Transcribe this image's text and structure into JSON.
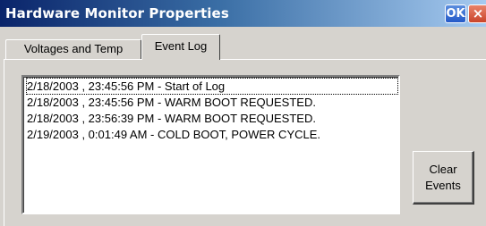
{
  "window": {
    "title": "Hardware Monitor Properties",
    "ok_label": "OK",
    "close_label": "×"
  },
  "tabs": [
    {
      "label": "Voltages and Temp",
      "active": false
    },
    {
      "label": "Event Log",
      "active": true
    }
  ],
  "event_log": {
    "entries": [
      "2/18/2003 , 23:45:56 PM - Start of Log",
      "2/18/2003 , 23:45:56 PM - WARM BOOT REQUESTED.",
      "2/18/2003 , 23:56:39 PM - WARM BOOT REQUESTED.",
      "2/19/2003 , 0:01:49 AM - COLD BOOT, POWER CYCLE."
    ]
  },
  "clear_button": {
    "line1": "Clear",
    "line2": "Events"
  },
  "colors": {
    "title_gradient_start": "#0a246a",
    "title_gradient_end": "#a6caf0",
    "face": "#d6d3ce",
    "ok_button": "#2459c8",
    "close_button": "#c9442a"
  }
}
